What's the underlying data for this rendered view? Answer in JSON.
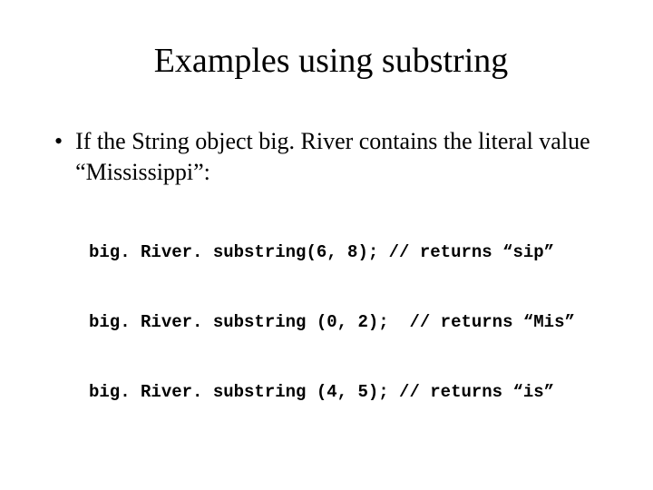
{
  "title": "Examples using substring",
  "bullet": {
    "marker": "•",
    "text": "If the String object big. River contains the literal value “Mississippi”:"
  },
  "code": {
    "line1": "big. River. substring(6, 8); // returns “sip”",
    "line2": "big. River. substring (0, 2);  // returns “Mis”",
    "line3": "big. River. substring (4, 5); // returns “is”"
  }
}
